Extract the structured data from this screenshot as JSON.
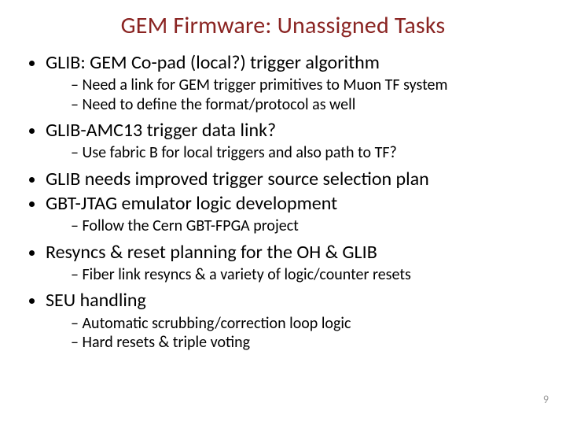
{
  "title": "GEM Firmware: Unassigned Tasks",
  "bullets": {
    "b0": {
      "text": "GLIB: GEM Co-pad (local?) trigger algorithm",
      "sub": [
        "Need a link for GEM trigger primitives to Muon TF system",
        "Need to define the format/protocol as well"
      ]
    },
    "b1": {
      "text": "GLIB-AMC13 trigger data link?",
      "sub": [
        "Use fabric B for local triggers and also path to TF?"
      ]
    },
    "b2": {
      "text": "GLIB needs improved trigger source selection plan"
    },
    "b3": {
      "text": "GBT-JTAG emulator logic development",
      "sub": [
        "Follow the Cern GBT-FPGA project"
      ]
    },
    "b4": {
      "text": "Resyncs & reset planning for the OH & GLIB",
      "sub": [
        "Fiber link resyncs & a variety of logic/counter resets"
      ]
    },
    "b5": {
      "text": "SEU handling",
      "sub": [
        "Automatic scrubbing/correction loop logic",
        "Hard resets & triple voting"
      ]
    }
  },
  "page_number": "9"
}
